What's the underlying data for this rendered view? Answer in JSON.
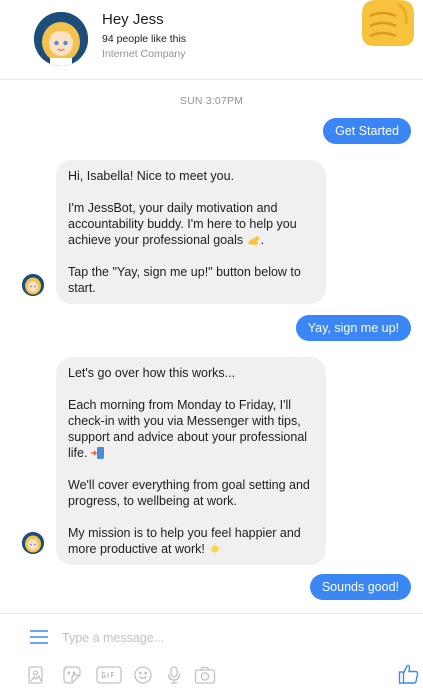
{
  "header": {
    "page_name": "Hey Jess",
    "likes": "94 people like this",
    "category": "Internet Company"
  },
  "conversation": {
    "timestamp": "SUN 3:07PM",
    "messages": [
      {
        "from": "user",
        "text": "Get Started"
      },
      {
        "from": "bot",
        "paragraphs": [
          "Hi, Isabella! Nice to meet you.",
          "I'm JessBot, your daily motivation and accountability buddy. I'm here to help you achieve your professional goals",
          "Tap the \"Yay, sign me up!\" button below to start."
        ],
        "emoji": "flexed-biceps"
      },
      {
        "from": "user",
        "text": "Yay, sign me up!"
      },
      {
        "from": "bot",
        "paragraphs": [
          "Let's go over how this works...",
          "Each morning from Monday to Friday, I'll check-in with you via Messenger with tips, support and advice about your professional life.",
          "We'll cover everything from goal setting and progress, to wellbeing at work.",
          "My mission is to help you feel happier and more productive at work!"
        ],
        "emojis": [
          "phone-with-arrow",
          "sun"
        ]
      },
      {
        "from": "user",
        "text": "Sounds good!"
      }
    ]
  },
  "composer": {
    "placeholder": "Type a message...",
    "tools": [
      "image-icon",
      "sticker-icon",
      "gif-icon",
      "emoji-icon",
      "microphone-icon",
      "camera-icon"
    ],
    "send_icon": "thumbs-up-icon"
  },
  "colors": {
    "accent": "#3a86f5",
    "incoming_bubble": "#f1f0f0",
    "muted_text": "#90949c"
  }
}
